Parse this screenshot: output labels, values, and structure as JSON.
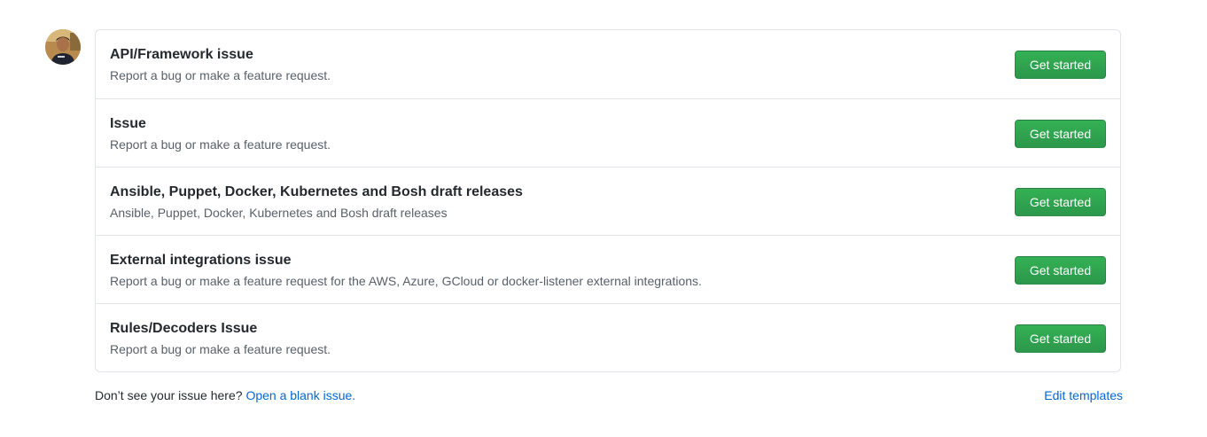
{
  "templates": [
    {
      "title": "API/Framework issue",
      "description": "Report a bug or make a feature request.",
      "button_label": "Get started"
    },
    {
      "title": "Issue",
      "description": "Report a bug or make a feature request.",
      "button_label": "Get started"
    },
    {
      "title": "Ansible, Puppet, Docker, Kubernetes and Bosh draft releases",
      "description": "Ansible, Puppet, Docker, Kubernetes and Bosh draft releases",
      "button_label": "Get started"
    },
    {
      "title": "External integrations issue",
      "description": "Report a bug or make a feature request for the AWS, Azure, GCloud or docker-listener external integrations.",
      "button_label": "Get started"
    },
    {
      "title": "Rules/Decoders Issue",
      "description": "Report a bug or make a feature request.",
      "button_label": "Get started"
    }
  ],
  "footer": {
    "prompt_text": "Don’t see your issue here?",
    "blank_issue_link": "Open a blank issue.",
    "edit_templates_link": "Edit templates"
  },
  "colors": {
    "button_green": "#2ea44f",
    "link_blue": "#0366d6",
    "border": "#e1e4e8"
  },
  "icons": {
    "avatar": "user-avatar"
  }
}
